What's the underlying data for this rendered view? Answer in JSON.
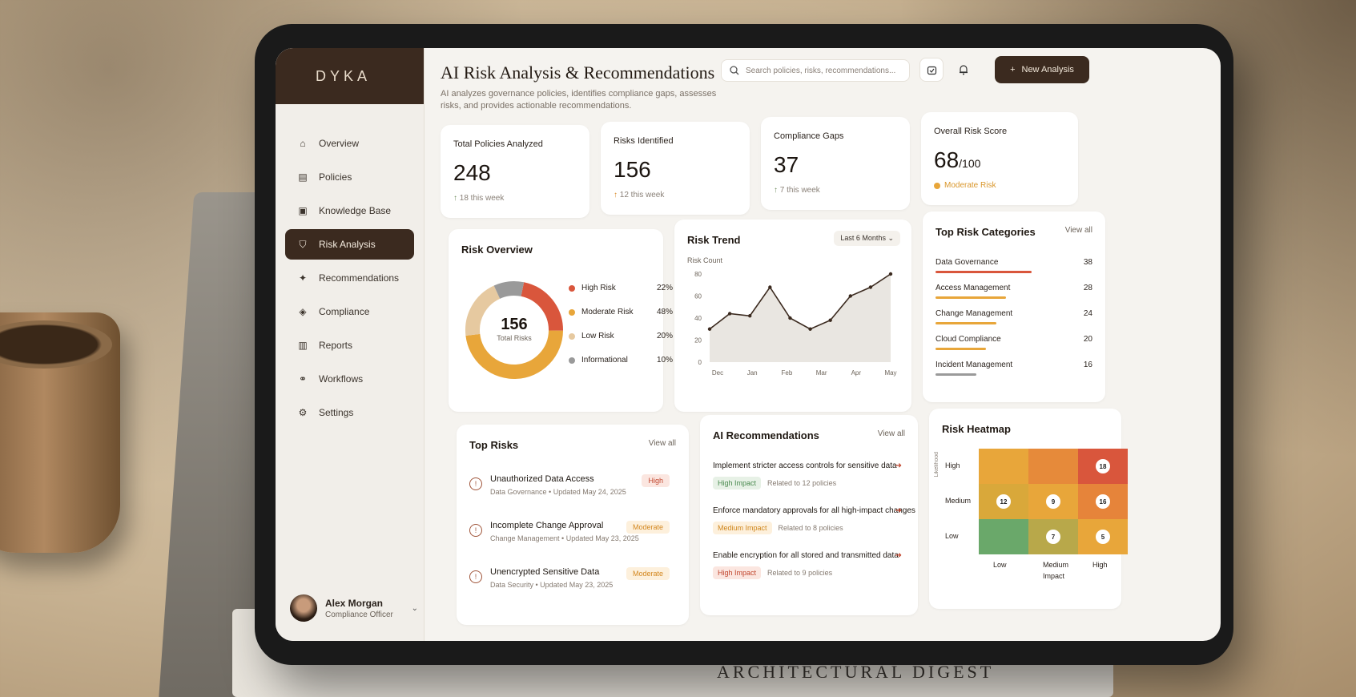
{
  "app": {
    "logo": "DYKA"
  },
  "sidebar": {
    "items": [
      {
        "label": "Overview",
        "icon": "home-icon"
      },
      {
        "label": "Policies",
        "icon": "document-icon"
      },
      {
        "label": "Knowledge Base",
        "icon": "book-icon"
      },
      {
        "label": "Risk Analysis",
        "icon": "shield-icon",
        "active": true
      },
      {
        "label": "Recommendations",
        "icon": "lightbulb-icon"
      },
      {
        "label": "Compliance",
        "icon": "check-shield-icon"
      },
      {
        "label": "Reports",
        "icon": "chart-icon"
      },
      {
        "label": "Workflows",
        "icon": "workflow-icon"
      },
      {
        "label": "Settings",
        "icon": "gear-icon"
      }
    ],
    "profile": {
      "name": "Alex Morgan",
      "role": "Compliance Officer"
    }
  },
  "header": {
    "title": "AI Risk Analysis & Recommendations",
    "subtitle": "AI analyzes governance policies, identifies compliance gaps, assesses risks, and provides actionable recommendations.",
    "search_placeholder": "Search policies, risks, recommendations...",
    "new_button": "New Analysis"
  },
  "stats": [
    {
      "label": "Total Policies Analyzed",
      "value": "248",
      "sub": "18 this week"
    },
    {
      "label": "Risks Identified",
      "value": "156",
      "sub": "12 this week"
    },
    {
      "label": "Compliance Gaps",
      "value": "37",
      "sub": "7 this week"
    }
  ],
  "score": {
    "label": "Overall Risk Score",
    "value": "68",
    "max": "/100",
    "status": "Moderate Risk"
  },
  "risk_overview": {
    "title": "Risk Overview",
    "total": "156",
    "total_label": "Total Risks",
    "segments": [
      {
        "label": "High Risk",
        "pct": "22%",
        "value": 22,
        "color": "#d9563c"
      },
      {
        "label": "Moderate Risk",
        "pct": "48%",
        "value": 48,
        "color": "#e8a63a"
      },
      {
        "label": "Low Risk",
        "pct": "20%",
        "value": 20,
        "color": "#e6c9a0"
      },
      {
        "label": "Informational",
        "pct": "10%",
        "value": 10,
        "color": "#9a9a9a"
      }
    ]
  },
  "trend": {
    "title": "Risk Trend",
    "range": "Last 6 Months",
    "ylabel": "Risk Count"
  },
  "chart_data": {
    "type": "area",
    "x": [
      "Dec",
      "Jan",
      "Feb",
      "Mar",
      "Apr",
      "May"
    ],
    "y_ticks": [
      "0",
      "20",
      "40",
      "60",
      "80"
    ],
    "values": [
      30,
      44,
      42,
      68,
      40,
      30,
      38,
      60,
      68,
      80
    ],
    "ylim": [
      0,
      80
    ],
    "ylabel": "Risk Count"
  },
  "categories": {
    "title": "Top Risk Categories",
    "view_all": "View all",
    "items": [
      {
        "label": "Data Governance",
        "count": "38",
        "value": 38,
        "color": "#d9563c"
      },
      {
        "label": "Access Management",
        "count": "28",
        "value": 28,
        "color": "#e8a63a"
      },
      {
        "label": "Change Management",
        "count": "24",
        "value": 24,
        "color": "#e8a63a"
      },
      {
        "label": "Cloud Compliance",
        "count": "20",
        "value": 20,
        "color": "#e8a63a"
      },
      {
        "label": "Incident Management",
        "count": "16",
        "value": 16,
        "color": "#9a9a9a"
      }
    ]
  },
  "top_risks": {
    "title": "Top Risks",
    "view_all": "View all",
    "items": [
      {
        "name": "Unauthorized Data Access",
        "meta": "Data Governance • Updated May 24, 2025",
        "badge": "High",
        "level": "high"
      },
      {
        "name": "Incomplete Change Approval",
        "meta": "Change Management • Updated May 23, 2025",
        "badge": "Moderate",
        "level": "moderate"
      },
      {
        "name": "Unencrypted Sensitive Data",
        "meta": "Data Security • Updated May 23, 2025",
        "badge": "Moderate",
        "level": "moderate"
      }
    ]
  },
  "recommendations": {
    "title": "AI Recommendations",
    "view_all": "View all",
    "items": [
      {
        "text": "Implement stricter access controls for sensitive data",
        "tag": "High Impact",
        "tag_class": "high",
        "related": "Related to 12 policies"
      },
      {
        "text": "Enforce mandatory approvals for all high-impact changes",
        "tag": "Medium Impact",
        "tag_class": "medium",
        "related": "Related to 8 policies"
      },
      {
        "text": "Enable encryption for all stored and transmitted data",
        "tag": "High Impact",
        "tag_class": "highr",
        "related": "Related to 9 policies"
      }
    ]
  },
  "heatmap": {
    "title": "Risk Heatmap",
    "y_labels": [
      "High",
      "Medium",
      "Low"
    ],
    "x_labels": [
      "Low",
      "Medium",
      "High"
    ],
    "x_title": "Impact",
    "y_title": "Likelihood",
    "cells": [
      {
        "color": "#e8a63a",
        "num": ""
      },
      {
        "color": "#e68a3a",
        "num": ""
      },
      {
        "color": "#d9563c",
        "num": "18"
      },
      {
        "color": "#d9a83a",
        "num": "12"
      },
      {
        "color": "#e8a63a",
        "num": "9"
      },
      {
        "color": "#e6843a",
        "num": "16"
      },
      {
        "color": "#6aa86a",
        "num": ""
      },
      {
        "color": "#b8a84a",
        "num": "7"
      },
      {
        "color": "#e8a63a",
        "num": "5"
      }
    ]
  }
}
